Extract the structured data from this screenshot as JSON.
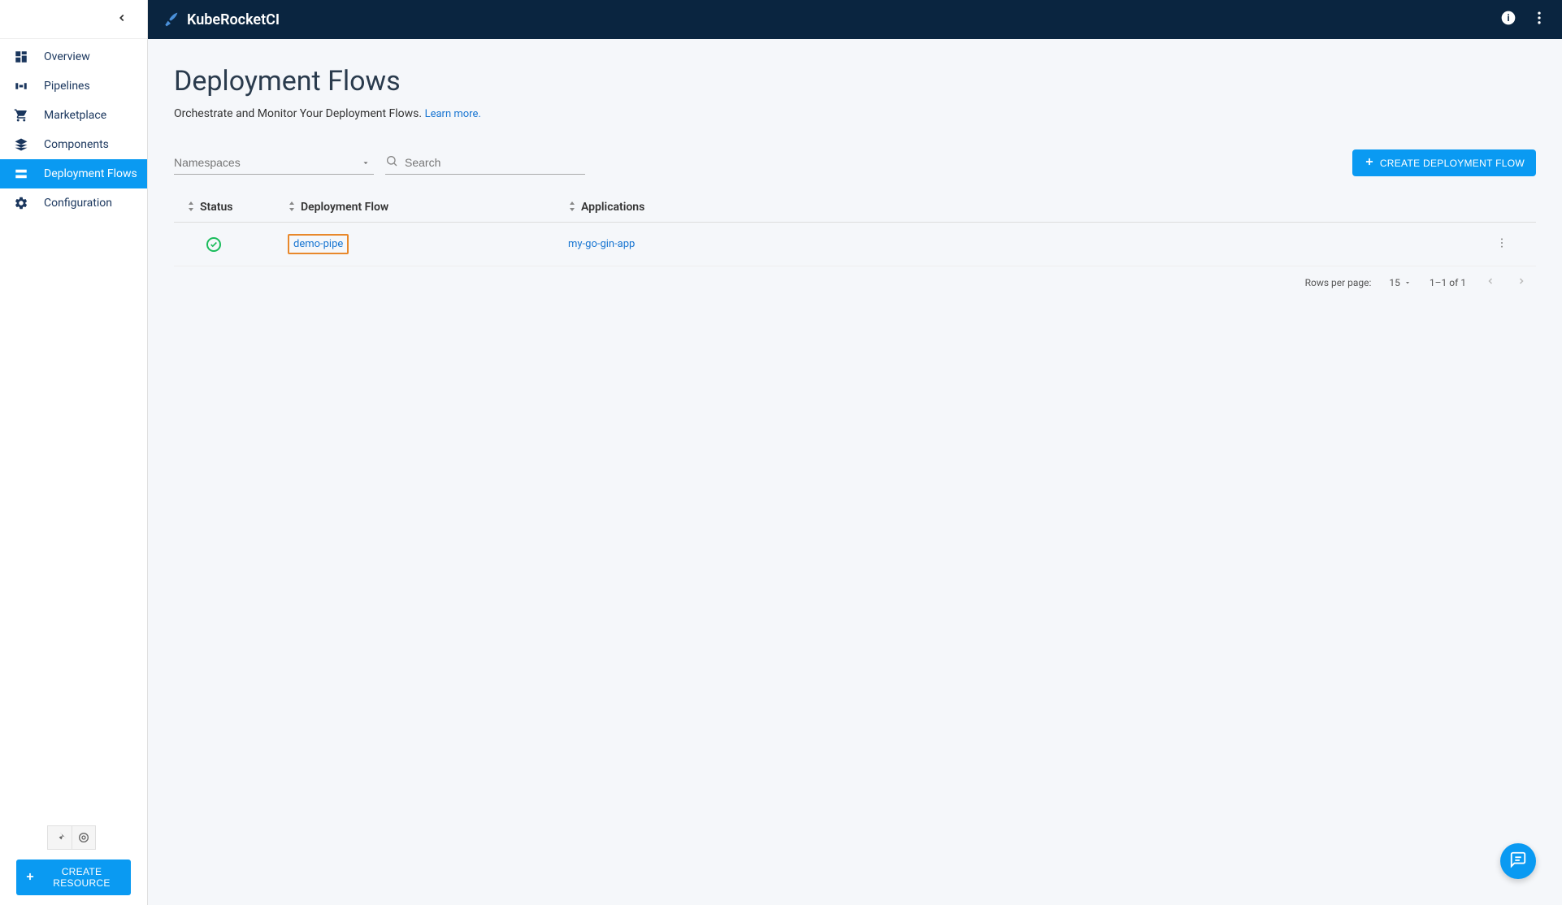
{
  "brand": {
    "name": "KubeRocketCI"
  },
  "sidebar": {
    "items": [
      {
        "label": "Overview"
      },
      {
        "label": "Pipelines"
      },
      {
        "label": "Marketplace"
      },
      {
        "label": "Components"
      },
      {
        "label": "Deployment Flows"
      },
      {
        "label": "Configuration"
      }
    ],
    "create_resource_label": "CREATE RESOURCE"
  },
  "page": {
    "title": "Deployment Flows",
    "subtitle": "Orchestrate and Monitor Your Deployment Flows.",
    "learn_more": "Learn more."
  },
  "filters": {
    "namespaces_placeholder": "Namespaces",
    "search_placeholder": "Search",
    "create_button": "CREATE DEPLOYMENT FLOW"
  },
  "table": {
    "columns": {
      "status": "Status",
      "flow": "Deployment Flow",
      "apps": "Applications"
    },
    "rows": [
      {
        "flow_name": "demo-pipe",
        "app_name": "my-go-gin-app"
      }
    ]
  },
  "pagination": {
    "rows_label": "Rows per page:",
    "rows_value": "15",
    "range": "1–1 of 1"
  }
}
